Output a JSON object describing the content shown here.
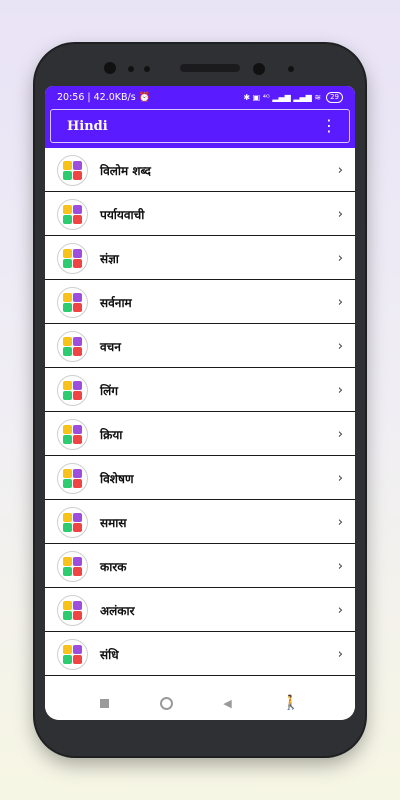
{
  "status": {
    "time_speed": "20:56 | 42.0KB/s",
    "alarm_icon": "alarm-icon",
    "right_icons": "✱ ▣ ⁴ᴳ ▂▄▆ ▂▄▆ ≋",
    "battery": "29"
  },
  "appbar": {
    "title": "Hindi"
  },
  "items": [
    {
      "label": "विलोम शब्द"
    },
    {
      "label": "पर्यायवाची"
    },
    {
      "label": "संज्ञा"
    },
    {
      "label": "सर्वनाम"
    },
    {
      "label": "वचन"
    },
    {
      "label": "लिंग"
    },
    {
      "label": "क्रिया"
    },
    {
      "label": "विशेषण"
    },
    {
      "label": "समास"
    },
    {
      "label": "कारक"
    },
    {
      "label": "अलंकार"
    },
    {
      "label": "संधि"
    }
  ],
  "chevron": "›",
  "colors": {
    "accent": "#5a1bff",
    "logo": [
      "#f7c21b",
      "#9d4edd",
      "#2ecc71",
      "#ef4444"
    ]
  }
}
